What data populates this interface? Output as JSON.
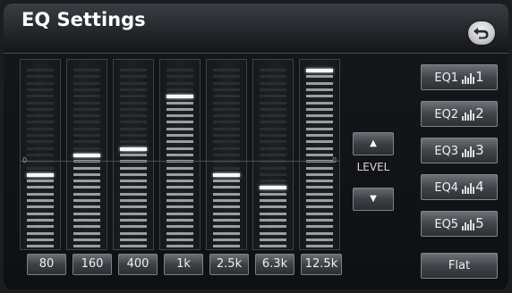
{
  "header": {
    "title": "EQ Settings",
    "back_icon": "back-arrow-icon"
  },
  "equalizer": {
    "segments_per_band": 28,
    "bands": [
      {
        "label": "80",
        "level_segment": 11
      },
      {
        "label": "160",
        "level_segment": 14
      },
      {
        "label": "400",
        "level_segment": 15
      },
      {
        "label": "1k",
        "level_segment": 23
      },
      {
        "label": "2.5k",
        "level_segment": 11
      },
      {
        "label": "6.3k",
        "level_segment": 9
      },
      {
        "label": "12.5k",
        "level_segment": 27
      }
    ],
    "zero_segment": 13,
    "zero_marks": [
      "0",
      "0"
    ]
  },
  "level": {
    "label": "LEVEL",
    "up_icon": "triangle-up-icon",
    "down_icon": "triangle-down-icon"
  },
  "presets": [
    {
      "label": "EQ1",
      "num": "1"
    },
    {
      "label": "EQ2",
      "num": "2"
    },
    {
      "label": "EQ3",
      "num": "3"
    },
    {
      "label": "EQ4",
      "num": "4"
    },
    {
      "label": "EQ5",
      "num": "5"
    }
  ],
  "flat_label": "Flat",
  "colors": {
    "knob": "#f7f7f7",
    "lit": "#9a9ea3",
    "unlit": "#2a2d31"
  }
}
